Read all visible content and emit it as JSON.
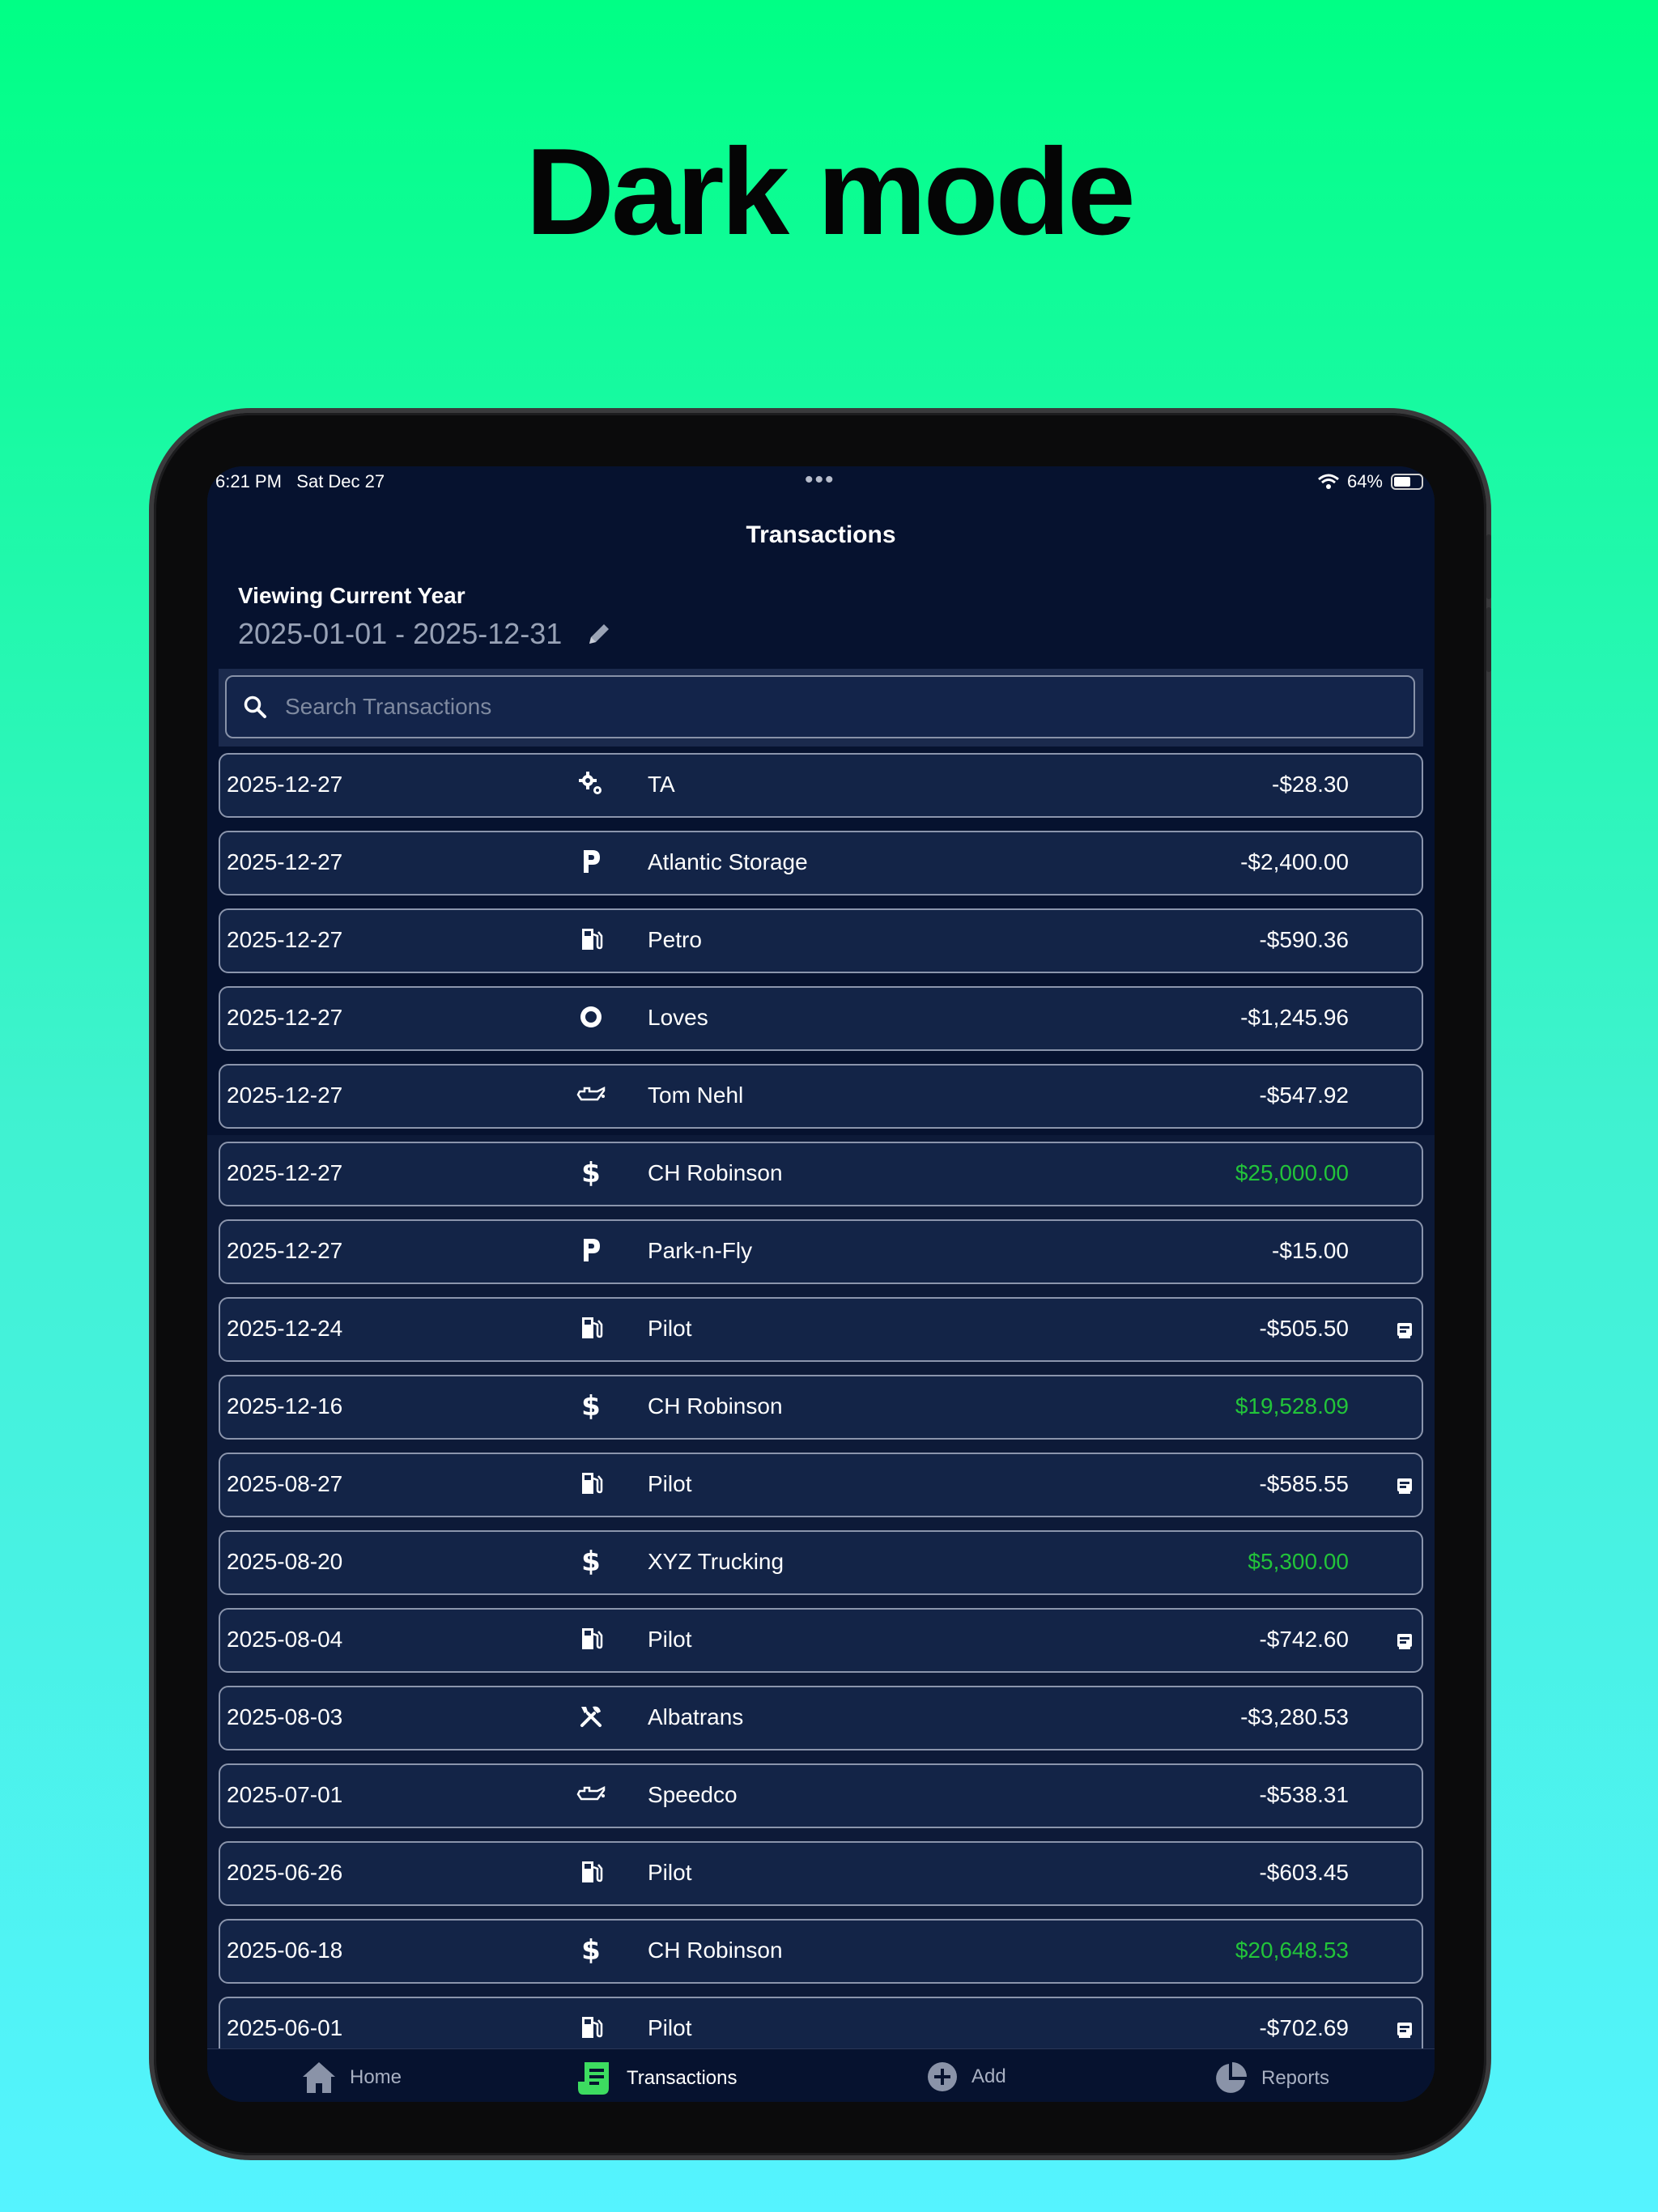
{
  "headline": "Dark mode",
  "status_bar": {
    "time": "6:21 PM",
    "date": "Sat Dec 27",
    "battery": "64%",
    "battery_level": 0.64
  },
  "nav": {
    "title": "Transactions"
  },
  "period": {
    "label": "Viewing Current Year",
    "range": "2025-01-01 - 2025-12-31"
  },
  "search": {
    "placeholder": "Search Transactions",
    "value": ""
  },
  "colors": {
    "positive": "#22c43a",
    "row_bg": "#132447",
    "accent_tab": "#3ddc60"
  },
  "transactions": [
    {
      "date": "2025-12-27",
      "icon": "gears-icon",
      "payee": "TA",
      "amount": "-$28.30",
      "positive": false,
      "receipt": false
    },
    {
      "date": "2025-12-27",
      "icon": "parking-icon",
      "payee": "Atlantic Storage",
      "amount": "-$2,400.00",
      "positive": false,
      "receipt": false
    },
    {
      "date": "2025-12-27",
      "icon": "fuel-pump-icon",
      "payee": "Petro",
      "amount": "-$590.36",
      "positive": false,
      "receipt": false
    },
    {
      "date": "2025-12-27",
      "icon": "tire-icon",
      "payee": "Loves",
      "amount": "-$1,245.96",
      "positive": false,
      "receipt": false
    },
    {
      "date": "2025-12-27",
      "icon": "oil-can-icon",
      "payee": "Tom Nehl",
      "amount": "-$547.92",
      "positive": false,
      "receipt": false
    },
    {
      "date": "2025-12-27",
      "icon": "dollar-icon",
      "payee": "CH Robinson",
      "amount": "$25,000.00",
      "positive": true,
      "receipt": false
    },
    {
      "date": "2025-12-27",
      "icon": "parking-icon",
      "payee": "Park-n-Fly",
      "amount": "-$15.00",
      "positive": false,
      "receipt": false
    },
    {
      "date": "2025-12-24",
      "icon": "fuel-pump-icon",
      "payee": "Pilot",
      "amount": "-$505.50",
      "positive": false,
      "receipt": true
    },
    {
      "date": "2025-12-16",
      "icon": "dollar-icon",
      "payee": "CH Robinson",
      "amount": "$19,528.09",
      "positive": true,
      "receipt": false
    },
    {
      "date": "2025-08-27",
      "icon": "fuel-pump-icon",
      "payee": "Pilot",
      "amount": "-$585.55",
      "positive": false,
      "receipt": true
    },
    {
      "date": "2025-08-20",
      "icon": "dollar-icon",
      "payee": "XYZ Trucking",
      "amount": "$5,300.00",
      "positive": true,
      "receipt": false
    },
    {
      "date": "2025-08-04",
      "icon": "fuel-pump-icon",
      "payee": "Pilot",
      "amount": "-$742.60",
      "positive": false,
      "receipt": true
    },
    {
      "date": "2025-08-03",
      "icon": "tools-icon",
      "payee": "Albatrans",
      "amount": "-$3,280.53",
      "positive": false,
      "receipt": false
    },
    {
      "date": "2025-07-01",
      "icon": "oil-can-icon",
      "payee": "Speedco",
      "amount": "-$538.31",
      "positive": false,
      "receipt": false
    },
    {
      "date": "2025-06-26",
      "icon": "fuel-pump-icon",
      "payee": "Pilot",
      "amount": "-$603.45",
      "positive": false,
      "receipt": false
    },
    {
      "date": "2025-06-18",
      "icon": "dollar-icon",
      "payee": "CH Robinson",
      "amount": "$20,648.53",
      "positive": true,
      "receipt": false
    },
    {
      "date": "2025-06-01",
      "icon": "fuel-pump-icon",
      "payee": "Pilot",
      "amount": "-$702.69",
      "positive": false,
      "receipt": true
    }
  ],
  "tabs": [
    {
      "label": "Home",
      "icon": "house-icon",
      "active": false
    },
    {
      "label": "Transactions",
      "icon": "receipt-icon",
      "active": true
    },
    {
      "label": "Add",
      "icon": "plus-circle-icon",
      "active": false
    },
    {
      "label": "Reports",
      "icon": "pie-chart-icon",
      "active": false
    }
  ]
}
